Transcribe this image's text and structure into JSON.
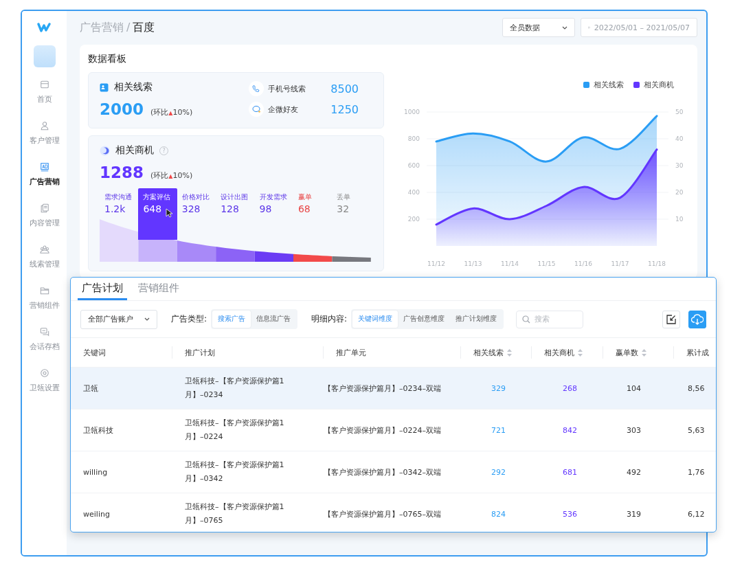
{
  "sidebar": {
    "items": [
      {
        "label": "首页",
        "selected": false
      },
      {
        "label": "客户管理",
        "selected": false
      },
      {
        "label": "广告营销",
        "selected": true
      },
      {
        "label": "内容管理",
        "selected": false
      },
      {
        "label": "线索管理",
        "selected": false
      },
      {
        "label": "营销组件",
        "selected": false
      },
      {
        "label": "会话存档",
        "selected": false
      },
      {
        "label": "卫瓴设置",
        "selected": false
      }
    ]
  },
  "breadcrumb": {
    "parent": "广告营销",
    "separator": "/",
    "current": "百度"
  },
  "member_select": {
    "value": "全员数据"
  },
  "date_range": {
    "value": "2022/05/01 – 2021/05/07"
  },
  "dashboard": {
    "title": "数据看板",
    "leads": {
      "title": "相关线索",
      "value": "2000",
      "compare": {
        "prefix": "(环比",
        "arrow": "▲",
        "suffix": "10%)"
      },
      "sources": [
        {
          "label": "手机号线索",
          "value": "8500"
        },
        {
          "label": "企微好友",
          "value": "1250"
        }
      ]
    },
    "opportunities": {
      "title": "相关商机",
      "help": "?",
      "value": "1288",
      "compare": {
        "prefix": "(环比",
        "arrow": "▲",
        "suffix": "10%)"
      },
      "stages": [
        {
          "label": "需求沟通",
          "value": "1.2k",
          "kind": "stage",
          "color": "#e4dafc",
          "selected": false
        },
        {
          "label": "方案评估",
          "value": "648",
          "kind": "stage",
          "color": "#c7b3fb",
          "selected": true
        },
        {
          "label": "价格对比",
          "value": "328",
          "kind": "stage",
          "color": "#a889f8",
          "selected": false
        },
        {
          "label": "设计出图",
          "value": "128",
          "kind": "stage",
          "color": "#8c63f6",
          "selected": false
        },
        {
          "label": "开发需求",
          "value": "98",
          "kind": "stage",
          "color": "#6b3cf4",
          "selected": false
        },
        {
          "label": "赢单",
          "value": "68",
          "kind": "won",
          "color": "#f24a4a",
          "selected": false
        },
        {
          "label": "丢单",
          "value": "32",
          "kind": "lost",
          "color": "#77787e",
          "selected": false
        }
      ]
    },
    "chart_data": {
      "type": "area",
      "categories": [
        "11/12",
        "11/13",
        "11/14",
        "11/15",
        "11/16",
        "11/17",
        "11/18"
      ],
      "series": [
        {
          "name": "相关线索",
          "color": "#2a9df4",
          "values": [
            780,
            840,
            780,
            630,
            810,
            725,
            970
          ]
        },
        {
          "name": "相关商机",
          "color": "#6236ff",
          "axis": "y2",
          "values": [
            8,
            14,
            10,
            15,
            22,
            18,
            36
          ]
        }
      ],
      "ylim": [
        0,
        1000
      ],
      "yticks": [
        200,
        400,
        600,
        800,
        1000
      ],
      "y2lim": [
        0,
        50
      ],
      "y2ticks": [
        10,
        20,
        30,
        40,
        50
      ],
      "grid": true,
      "legend": "top-right"
    }
  },
  "plan_panel": {
    "tabs": [
      {
        "label": "广告计划",
        "selected": true
      },
      {
        "label": "营销组件",
        "selected": false
      }
    ],
    "account_select": {
      "value": "全部广告账户"
    },
    "ad_type": {
      "label": "广告类型:",
      "options": [
        {
          "label": "搜索广告",
          "selected": true
        },
        {
          "label": "信息流广告",
          "selected": false
        }
      ]
    },
    "detail": {
      "label": "明细内容:",
      "options": [
        {
          "label": "关键词维度",
          "selected": true
        },
        {
          "label": "广告创意维度",
          "selected": false
        },
        {
          "label": "推广计划维度",
          "selected": false
        }
      ]
    },
    "search": {
      "placeholder": "搜索"
    },
    "table": {
      "columns": [
        {
          "label": "关键词",
          "sortable": false
        },
        {
          "label": "推广计划",
          "sortable": false
        },
        {
          "label": "推广单元",
          "sortable": false
        },
        {
          "label": "相关线索",
          "sortable": true
        },
        {
          "label": "相关商机",
          "sortable": true
        },
        {
          "label": "赢单数",
          "sortable": true
        },
        {
          "label": "累计成",
          "sortable": false
        }
      ],
      "rows": [
        {
          "selected": true,
          "cells": [
            "卫瓴",
            "卫瓴科技–【客户资源保护篇1月】–0234",
            "【客户资源保护篇月】–0234–双端",
            "329",
            "268",
            "104",
            "8,56"
          ]
        },
        {
          "selected": false,
          "cells": [
            "卫瓴科技",
            "卫瓴科技–【客户资源保护篇1月】–0224",
            "【客户资源保护篇月】–0224–双端",
            "721",
            "842",
            "303",
            "5,63"
          ]
        },
        {
          "selected": false,
          "cells": [
            "willing",
            "卫瓴科技–【客户资源保护篇1月】–0342",
            "【客户资源保护篇月】–0342–双端",
            "292",
            "681",
            "492",
            "1,76"
          ]
        },
        {
          "selected": false,
          "cells": [
            "weiling",
            "卫瓴科技–【客户资源保护篇1月】–0765",
            "【客户资源保护篇月】–0765–双端",
            "824",
            "536",
            "319",
            "6,12"
          ]
        }
      ]
    }
  }
}
